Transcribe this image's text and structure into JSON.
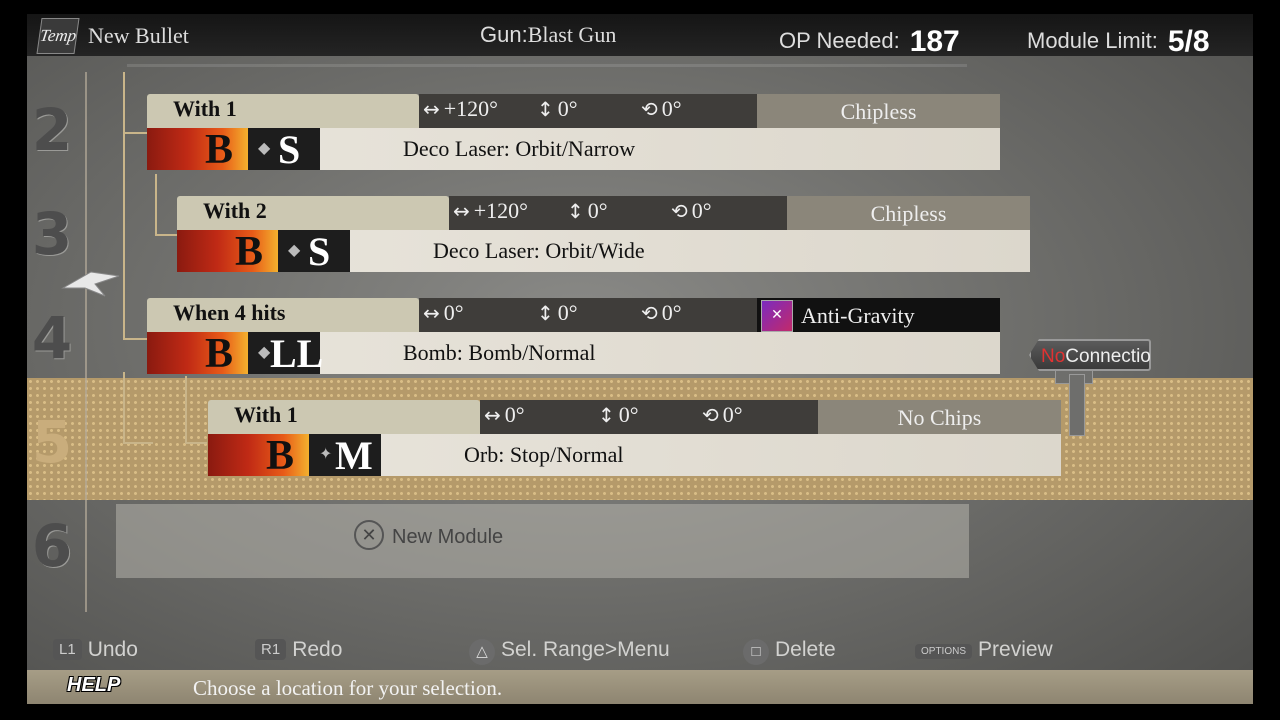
{
  "header": {
    "temp_icon": "Temp",
    "bullet_name": "New Bullet",
    "gun_label": "Gun:",
    "gun_value": "Blast Gun",
    "op_label": "OP Needed:",
    "op_value": "187",
    "limit_label": "Module  Limit:",
    "limit_value": "5/8"
  },
  "row_numbers": [
    "2",
    "3",
    "4",
    "5",
    "6"
  ],
  "modules": [
    {
      "condition": "With 1",
      "h": "+120°",
      "v": "0°",
      "r": "0°",
      "chip": "Chipless",
      "type": "B",
      "size": "S",
      "name": "Deco Laser: Orbit/Narrow"
    },
    {
      "condition": "With 2",
      "h": "+120°",
      "v": "0°",
      "r": "0°",
      "chip": "Chipless",
      "type": "B",
      "size": "S",
      "name": "Deco Laser: Orbit/Wide"
    },
    {
      "condition": "When 4 hits",
      "h": "0°",
      "v": "0°",
      "r": "0°",
      "chip": "Anti-Gravity",
      "type": "B",
      "size": "LL",
      "name": "Bomb: Bomb/Normal"
    },
    {
      "condition": "With 1",
      "h": "0°",
      "v": "0°",
      "r": "0°",
      "chip": "No Chips",
      "type": "B",
      "size": "M",
      "name": "Orb: Stop/Normal"
    }
  ],
  "new_module": {
    "button": "✕",
    "label": "New Module"
  },
  "connection": {
    "no": "No",
    "label": "Connection"
  },
  "controls": {
    "undo_key": "L1",
    "undo": "Undo",
    "redo_key": "R1",
    "redo": "Redo",
    "sel_key": "△",
    "sel": "Sel. Range>Menu",
    "delete_key": "□",
    "delete": "Delete",
    "preview_key": "OPTIONS",
    "preview": "Preview"
  },
  "help": {
    "label": "HELP",
    "text": "Choose a location for your selection."
  },
  "icons": {
    "h": "↔",
    "v": "↕",
    "r": "⟲"
  },
  "colors": {
    "highlight": "#b59a6a",
    "accent_red": "#e23232"
  }
}
